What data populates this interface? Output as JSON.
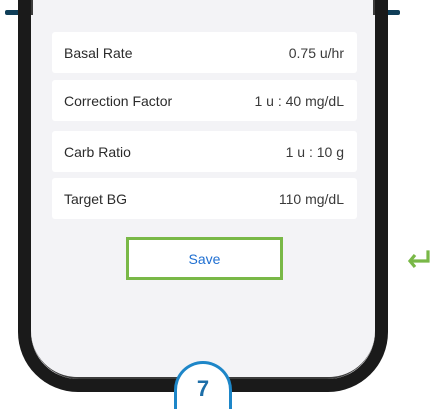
{
  "settings": {
    "rows": [
      {
        "label": "Basal Rate",
        "value": "0.75 u/hr"
      },
      {
        "label": "Correction Factor",
        "value": "1 u : 40 mg/dL"
      },
      {
        "label": "Carb Ratio",
        "value": "1 u : 10 g"
      },
      {
        "label": "Target BG",
        "value": "110 mg/dL"
      }
    ],
    "save_label": "Save"
  },
  "step_badge": "7",
  "icons": {
    "return": "return-arrow-icon"
  },
  "colors": {
    "accent_green": "#79b847",
    "link_blue": "#1f6fd1",
    "badge_blue": "#1d86c8",
    "header_bar": "#0f3e58"
  }
}
